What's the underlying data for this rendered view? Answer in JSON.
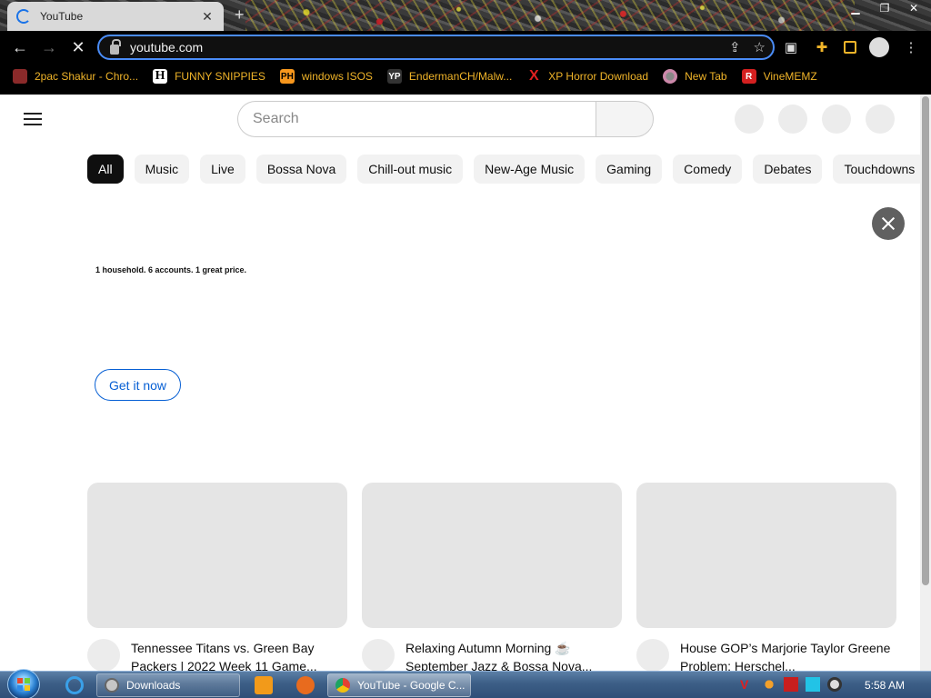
{
  "browser": {
    "tab": {
      "title": "YouTube"
    },
    "url": "youtube.com",
    "bookmarks": [
      {
        "label": "2pac Shakur - Chro...",
        "icon": "2pac-favicon"
      },
      {
        "label": "FUNNY SNIPPIES",
        "icon": "h-favicon"
      },
      {
        "label": "windows ISOS",
        "icon": "ph-favicon"
      },
      {
        "label": "EndermanCH/Malw...",
        "icon": "yp-favicon"
      },
      {
        "label": "XP Horror Download",
        "icon": "x-favicon"
      },
      {
        "label": "New Tab",
        "icon": "newtab-favicon"
      },
      {
        "label": "VineMEMZ",
        "icon": "r-favicon"
      }
    ],
    "fav_text": {
      "h": "H",
      "ph": "PH",
      "yp": "YP",
      "x": "X",
      "r": "R"
    }
  },
  "youtube": {
    "search": {
      "placeholder": "Search"
    },
    "chips": [
      "All",
      "Music",
      "Live",
      "Bossa Nova",
      "Chill-out music",
      "New-Age Music",
      "Gaming",
      "Comedy",
      "Debates",
      "Touchdowns"
    ],
    "promo": {
      "text": "1 household. 6 accounts. 1 great price.",
      "cta": "Get it now"
    },
    "videos": [
      {
        "title": "Tennessee Titans vs. Green Bay Packers | 2022 Week 11 Game..."
      },
      {
        "title": "Relaxing Autumn Morning ☕ September Jazz & Bossa Nova..."
      },
      {
        "title": "House GOP’s Marjorie Taylor Greene Problem: Herschel..."
      }
    ]
  },
  "taskbar": {
    "items": [
      {
        "label": "Downloads"
      },
      {
        "label": "YouTube - Google C..."
      }
    ],
    "clock": "5:58 AM"
  },
  "colors": {
    "accent_blue": "#065fd4",
    "bookmark_text": "#f0b429",
    "chip_active_bg": "#0f0f0f"
  }
}
